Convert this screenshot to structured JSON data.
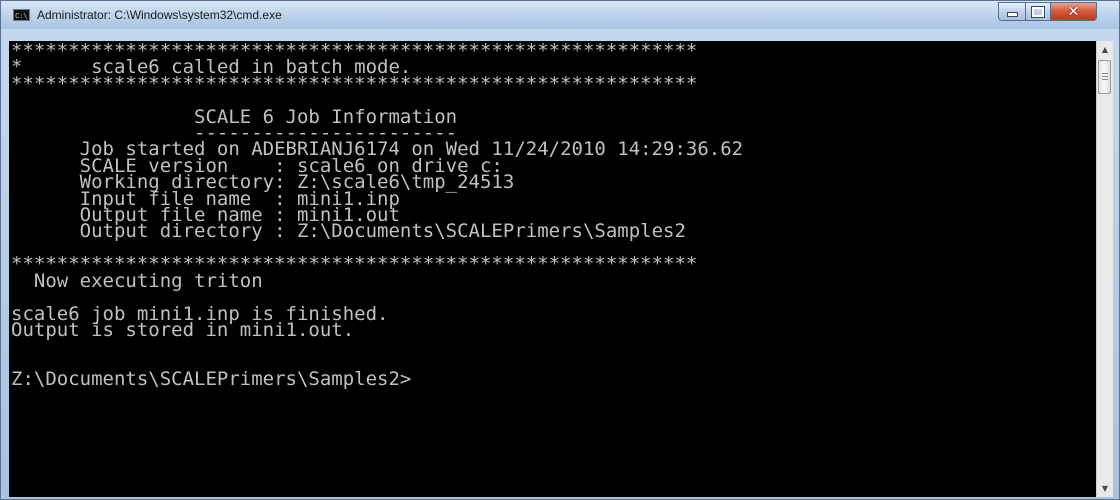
{
  "window": {
    "title": "Administrator: C:\\Windows\\system32\\cmd.exe",
    "icon": "cmd-icon",
    "icon_label": "C:\\"
  },
  "controls": {
    "minimize": "minimize-icon",
    "maximize": "maximize-icon",
    "close": "close-icon",
    "close_glyph": "✕"
  },
  "console": {
    "lines": [
      "************************************************************",
      "*      scale6 called in batch mode.",
      "************************************************************",
      "",
      "                SCALE 6 Job Information",
      "                -----------------------",
      "      Job started on ADEBRIANJ6174 on Wed 11/24/2010 14:29:36.62",
      "      SCALE version    : scale6 on drive c:",
      "      Working directory: Z:\\scale6\\tmp_24513",
      "      Input file name  : mini1.inp",
      "      Output file name : mini1.out",
      "      Output directory : Z:\\Documents\\SCALEPrimers\\Samples2",
      "",
      "************************************************************",
      "  Now executing triton",
      "",
      "scale6 job mini1.inp is finished.",
      "Output is stored in mini1.out.",
      "",
      "",
      "Z:\\Documents\\SCALEPrimers\\Samples2>"
    ]
  },
  "scrollbar": {
    "up_glyph": "▲",
    "down_glyph": "▼"
  },
  "colors": {
    "console_bg": "#000000",
    "console_fg": "#c0c0c0",
    "close_button": "#c2391a"
  }
}
